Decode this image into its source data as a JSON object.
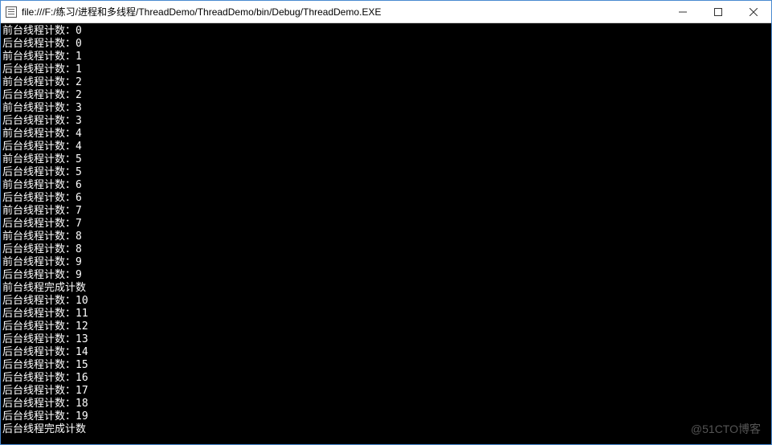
{
  "window": {
    "title": "file:///F:/练习/进程和多线程/ThreadDemo/ThreadDemo/bin/Debug/ThreadDemo.EXE"
  },
  "console": {
    "lines": [
      "前台线程计数：0",
      "后台线程计数：0",
      "前台线程计数：1",
      "后台线程计数：1",
      "前台线程计数：2",
      "后台线程计数：2",
      "前台线程计数：3",
      "后台线程计数：3",
      "前台线程计数：4",
      "后台线程计数：4",
      "前台线程计数：5",
      "后台线程计数：5",
      "前台线程计数：6",
      "后台线程计数：6",
      "前台线程计数：7",
      "后台线程计数：7",
      "前台线程计数：8",
      "后台线程计数：8",
      "前台线程计数：9",
      "后台线程计数：9",
      "前台线程完成计数",
      "后台线程计数：10",
      "后台线程计数：11",
      "后台线程计数：12",
      "后台线程计数：13",
      "后台线程计数：14",
      "后台线程计数：15",
      "后台线程计数：16",
      "后台线程计数：17",
      "后台线程计数：18",
      "后台线程计数：19",
      "后台线程完成计数"
    ]
  },
  "watermark": "@51CTO博客"
}
